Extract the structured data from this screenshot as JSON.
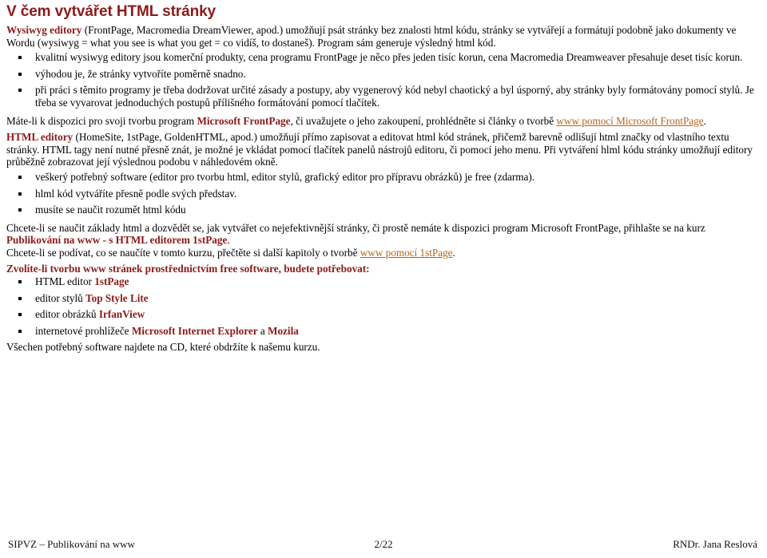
{
  "slide": {
    "title": "V čem vytvářet HTML stránky",
    "accent_color": "#8c1a1a",
    "link_color": "#b5651d",
    "text_color": "#000000",
    "background_color": "#ffffff",
    "bullet_glyph": "square"
  },
  "wysiwyg_paragraph": {
    "lead": "Wysiwyg editory",
    "rest": " (FrontPage, Macromedia DreamViewer, apod.) umožňují psát stránky bez znalosti html kódu, stránky se vytvářejí a formátují podobně jako dokumenty ve Wordu (wysiwyg = what you see is what you get = co vidíš, to dostaneš). Program sám generuje výsledný html kód."
  },
  "wysiwyg_bullets": [
    "kvalitní wysiwyg editory jsou komerční produkty, cena programu FrontPage je něco přes jeden tisíc korun, cena Macromedia Dreamweaver přesahuje deset tisíc korun.",
    "výhodou je, že stránky vytvoříte poměrně snadno.",
    "při práci s těmito programy je třeba dodržovat určité zásady a postupy, aby vygenerový kód nebyl chaotický a byl úsporný, aby stránky byly formátovány pomocí stylů. Je třeba se vyvarovat jednoduchých postupů přílišného formátování pomocí tlačítek."
  ],
  "frontpage_paragraph": {
    "before": "Máte-li k dispozici pro svoji tvorbu program ",
    "bold": "Microsoft FrontPage",
    "middle": ", či uvažujete o jeho zakoupení, prohlédněte si články o tvorbě ",
    "link": "www pomocí Microsoft FrontPage",
    "after": "."
  },
  "html_editors_paragraph": {
    "lead": "HTML editory",
    "rest": " (HomeSite, 1stPage, GoldenHTML, apod.) umožňují přímo zapisovat a editovat html kód stránek, přičemž barevně odlišují html značky od vlastního textu stránky. HTML tagy není nutné přesně znát, je možné je vkládat pomocí tlačítek panelů nástrojů editoru, či pomocí jeho menu. Při vytváření hlml kódu stránky umožňují editory průběžně zobrazovat její výslednou podobu v náhledovém okně."
  },
  "html_editors_bullets": [
    "veškerý potřebný software (editor pro tvorbu html, editor stylů, grafický editor pro přípravu obrázků) je free (zdarma).",
    "hlml kód vytváříte přesně podle svých představ.",
    "musíte se naučit rozumět html kódu"
  ],
  "course_paragraph": {
    "line1": "Chcete-li se naučit základy html a dozvědět se, jak vytvářet co nejefektivnější stránky, či prostě nemáte k dispozici program Microsoft FrontPage, přihlašte se na kurz",
    "course_name": "Publikování na www - s HTML editorem 1stPage",
    "course_name_suffix": ".",
    "line3_before": "Chcete-li se podívat, co se naučíte v tomto kurzu, přečtěte si další kapitoly o tvorbě ",
    "line3_link": "www pomocí 1stPage",
    "line3_after": "."
  },
  "free_software": {
    "heading": "Zvolíte-li tvorbu www stránek prostřednictvím free software, budete potřebovat:",
    "items": [
      {
        "prefix": "HTML editor ",
        "bold": "1stPage",
        "suffix": ""
      },
      {
        "prefix": "editor stylů ",
        "bold": "Top Style Lite",
        "suffix": ""
      },
      {
        "prefix": "editor obrázků ",
        "bold": "IrfanView",
        "suffix": ""
      },
      {
        "prefix": "internetové prohlížeče ",
        "bold": "Microsoft Internet Explorer",
        "middle": " a ",
        "bold2": "Mozila",
        "suffix": ""
      }
    ],
    "closing": "Všechen potřebný software najdete na CD, které obdržíte k našemu kurzu."
  },
  "footer": {
    "left": "SIPVZ – Publikování na www",
    "center": "2/22",
    "right": "RNDr. Jana Reslová"
  }
}
